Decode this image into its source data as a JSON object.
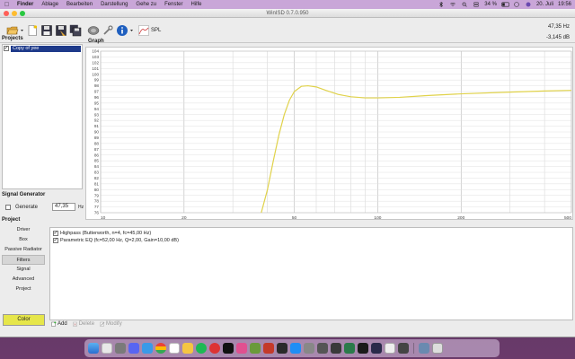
{
  "menubar": {
    "app": "Finder",
    "items": [
      "Ablage",
      "Bearbeiten",
      "Darstellung",
      "Gehe zu",
      "Fenster",
      "Hilfe"
    ],
    "battery": "34 %",
    "date": "20. Juli",
    "time": "19:56"
  },
  "window": {
    "title": "WinISD 0.7.0.950",
    "readout_freq": "47,35 Hz",
    "readout_db": "-3,145 dB"
  },
  "toolbar": {
    "spl_label": "SPL"
  },
  "projects": {
    "title": "Projects",
    "items": [
      {
        "name": "Copy of yee",
        "checked": true
      }
    ]
  },
  "graph": {
    "title": "Graph",
    "curve_color": "#e0d24a"
  },
  "signal_generator": {
    "title": "Signal Generator",
    "generate_label": "Generate",
    "frequency": "47,35",
    "unit": "Hz"
  },
  "project_nav": {
    "title": "Project",
    "items": [
      "Driver",
      "Box",
      "Passive Radiator",
      "Filters",
      "Signal",
      "Advanced",
      "Project"
    ],
    "active": "Filters",
    "color_label": "Color",
    "color_value": "#e6e64a"
  },
  "filters": {
    "items": [
      {
        "label": "Highpass (Butterworth, n=4, fc=45,00 Hz)",
        "checked": true
      },
      {
        "label": "Parametric EQ (fc=52,00 Hz, Q=2,00, Gain=10,00 dB)",
        "checked": true
      }
    ],
    "actions": {
      "add": "Add",
      "delete": "Delete",
      "modify": "Modify"
    }
  },
  "chart_data": {
    "type": "line",
    "x_scale": "log",
    "xlim": [
      10,
      500
    ],
    "ylim": [
      76,
      104
    ],
    "x_ticks": [
      10,
      20,
      50,
      100,
      200,
      500
    ],
    "y_ticks": [
      76,
      77,
      78,
      79,
      80,
      81,
      82,
      83,
      84,
      85,
      86,
      87,
      88,
      89,
      90,
      91,
      92,
      93,
      94,
      95,
      96,
      97,
      98,
      99,
      100,
      101,
      102,
      103,
      104
    ],
    "grid": true,
    "series": [
      {
        "color": "#e0d24a",
        "points": [
          [
            38,
            76
          ],
          [
            40,
            80
          ],
          [
            42,
            85
          ],
          [
            44,
            89.5
          ],
          [
            46,
            93
          ],
          [
            48,
            95.5
          ],
          [
            50,
            97
          ],
          [
            53,
            97.9
          ],
          [
            56,
            98
          ],
          [
            60,
            97.8
          ],
          [
            65,
            97.2
          ],
          [
            72,
            96.5
          ],
          [
            80,
            96.1
          ],
          [
            90,
            95.9
          ],
          [
            100,
            95.9
          ],
          [
            120,
            96
          ],
          [
            150,
            96.3
          ],
          [
            200,
            96.6
          ],
          [
            300,
            96.9
          ],
          [
            400,
            97.1
          ],
          [
            500,
            97.2
          ]
        ]
      }
    ]
  }
}
